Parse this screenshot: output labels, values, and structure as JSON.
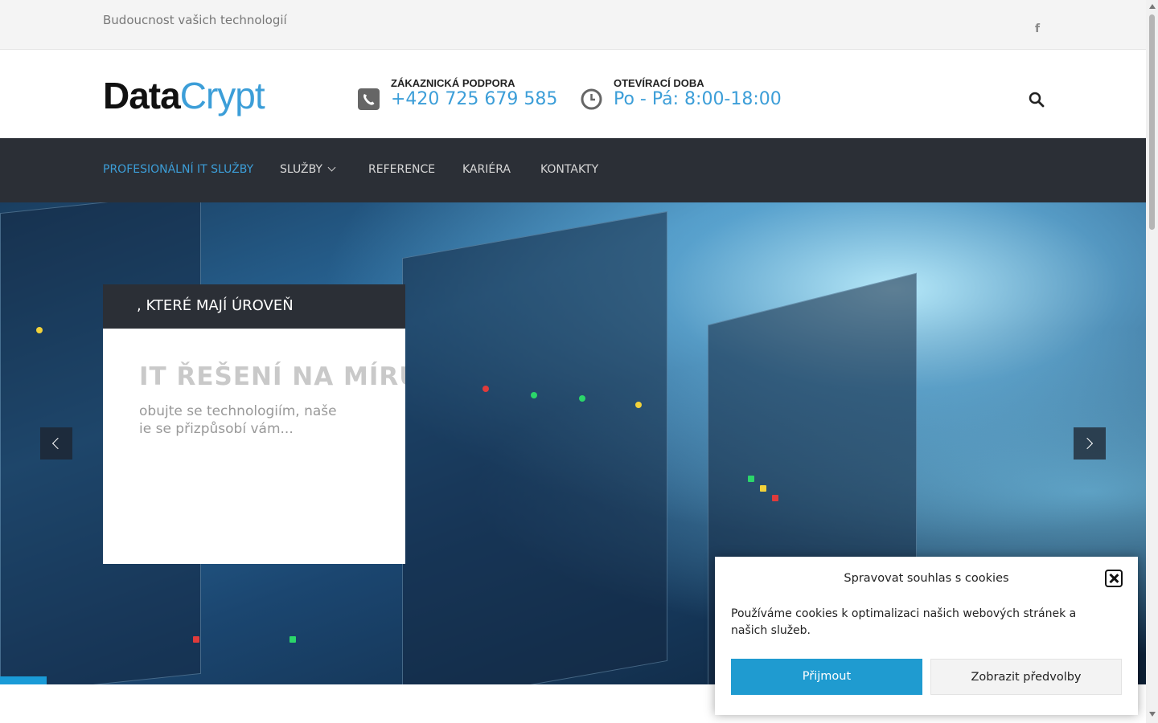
{
  "topbar": {
    "tagline": "Budoucnost vašich technologií",
    "facebook_icon": "f"
  },
  "header": {
    "logo_part1": "Data",
    "logo_part2": "Crypt",
    "support_label": "ZÁKAZNICKÁ PODPORA",
    "support_value": "+420 725 679 585",
    "hours_label": "OTEVÍRACÍ DOBA",
    "hours_value": "Po - Pá: 8:00-18:00"
  },
  "nav": {
    "items": [
      {
        "label": "PROFESIONÁLNÍ IT SLUŽBY"
      },
      {
        "label": "SLUŽBY"
      },
      {
        "label": "REFERENCE"
      },
      {
        "label": "KARIÉRA"
      },
      {
        "label": "KONTAKTY"
      }
    ]
  },
  "hero": {
    "banner_text": ", KTERÉ MAJÍ ÚROVEŇ",
    "slide_title": "IT ŘEŠENÍ NA MÍRU",
    "slide_text_line1": "obujte se technologiím, naše",
    "slide_text_line2": "ie se přizpůsobí vám..."
  },
  "cookie": {
    "title": "Spravovat souhlas s cookies",
    "text": "Používáme cookies k optimalizaci našich webových stránek a našich služeb.",
    "accept_label": "Přijmout",
    "prefs_label": "Zobrazit předvolby"
  },
  "colors": {
    "accent": "#3c9ed8",
    "nav_bg": "#2b2f36",
    "accept_button": "#1f9bd0"
  }
}
